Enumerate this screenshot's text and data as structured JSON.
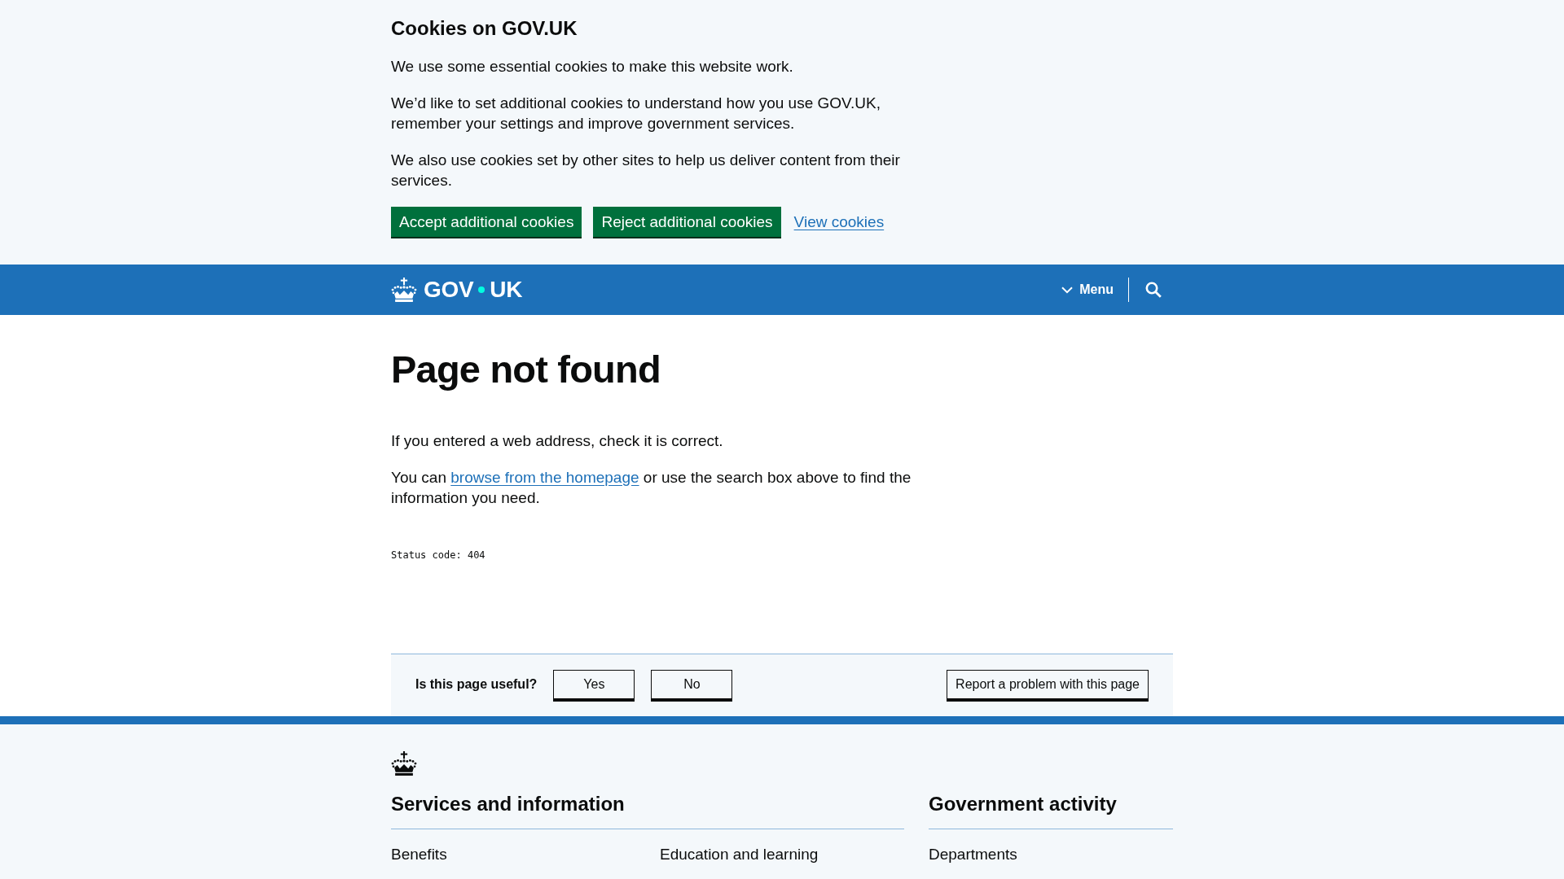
{
  "cookie_banner": {
    "title": "Cookies on GOV.UK",
    "paragraphs": [
      "We use some essential cookies to make this website work.",
      "We’d like to set additional cookies to understand how you use GOV.UK, remember your settings and improve government services.",
      "We also use cookies set by other sites to help us deliver content from their services."
    ],
    "actions": [
      {
        "kind": "button",
        "label": "Accept additional cookies"
      },
      {
        "kind": "button",
        "label": "Reject additional cookies"
      },
      {
        "kind": "link",
        "label": "View cookies"
      }
    ]
  },
  "header": {
    "logo": {
      "words": [
        "GOV",
        "UK"
      ]
    },
    "menu": {
      "label": "Menu",
      "expanded": false
    }
  },
  "main": {
    "title": "Page not found",
    "paragraphs": [
      {
        "kind": "text",
        "text": "If you entered a web address, check it is correct."
      },
      {
        "kind": "with_link",
        "before": "You can",
        "link": "browse from the homepage",
        "after": "or use the search box above to find the information you need."
      }
    ],
    "status_code": "Status code: 404"
  },
  "feedback": {
    "question": "Is this page useful?",
    "answers": [
      "Yes",
      "No"
    ],
    "report": "Report a problem with this page"
  },
  "footer": {
    "sections": [
      {
        "title": "Services and information",
        "links": [
          "Benefits",
          "Education and learning"
        ]
      },
      {
        "title": "Government activity",
        "links": [
          "Departments"
        ]
      }
    ]
  }
}
